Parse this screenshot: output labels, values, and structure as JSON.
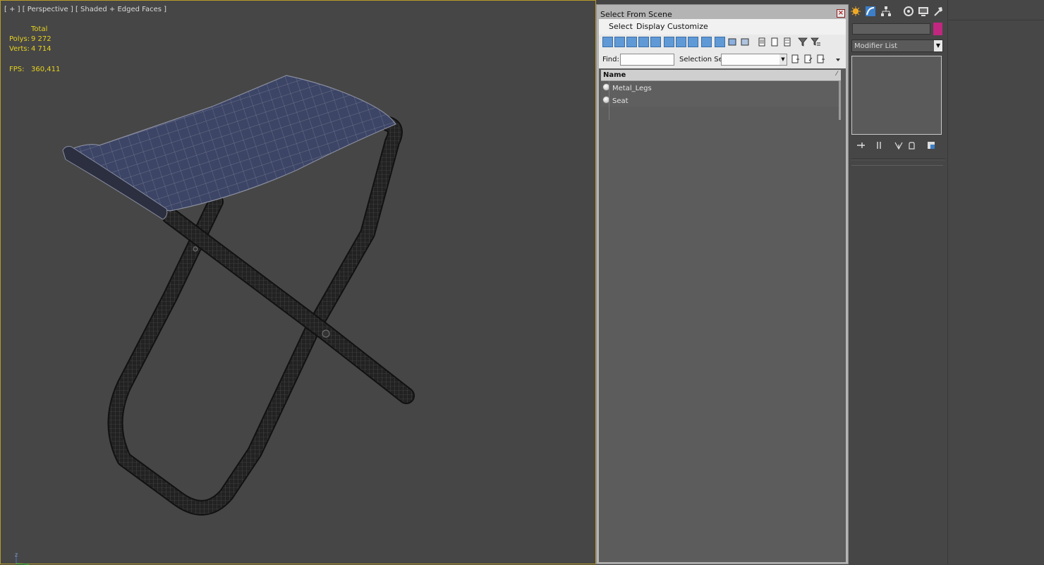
{
  "viewport": {
    "label": "[ + ] [ Perspective ] [ Shaded + Edged Faces ]",
    "stats": {
      "total_label": "Total",
      "polys_label": "Polys:",
      "polys_value": "9 272",
      "verts_label": "Verts:",
      "verts_value": "4 714",
      "fps_label": "FPS:",
      "fps_value": "360,411"
    },
    "axis_label": "z"
  },
  "dialog": {
    "title": "Select From Scene",
    "close_glyph": "×",
    "menus": [
      "Select",
      "Display",
      "Customize"
    ],
    "find_label": "Find:",
    "find_value": "",
    "selection_set_label": "Selection Set:",
    "selection_set_value": "",
    "column_header": "Name",
    "objects": [
      "Metal_Legs",
      "Seat"
    ]
  },
  "command_panel": {
    "tabs": [
      "create-icon",
      "modify-icon",
      "hierarchy-icon",
      "motion-icon",
      "display-icon",
      "utilities-icon"
    ],
    "name_value": "",
    "object_color": "#c0277f",
    "modifier_list_label": "Modifier List",
    "dropdown_glyph": "▼"
  },
  "colors": {
    "viewport_bg": "#464646",
    "stats_text": "#e6d21e",
    "active_border": "#b59a2a",
    "toolbar_blue": "#5f99d6"
  }
}
